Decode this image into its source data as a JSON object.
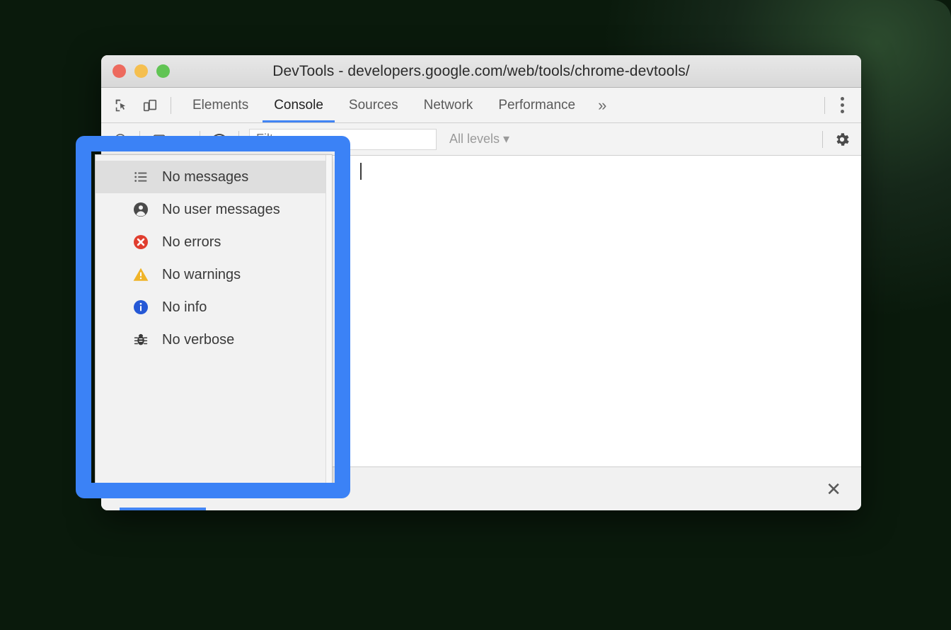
{
  "window": {
    "title": "DevTools - developers.google.com/web/tools/chrome-devtools/",
    "traffic_lights": [
      {
        "name": "close",
        "color": "#ed6a5e"
      },
      {
        "name": "minimize",
        "color": "#f5bf4f"
      },
      {
        "name": "zoom",
        "color": "#61c454"
      }
    ]
  },
  "tabstrip": {
    "left_icons": [
      {
        "name": "inspect-element-icon",
        "glyph": "inspect"
      },
      {
        "name": "device-toolbar-icon",
        "glyph": "device"
      }
    ],
    "tabs": [
      {
        "label": "Elements",
        "active": false
      },
      {
        "label": "Console",
        "active": true
      },
      {
        "label": "Sources",
        "active": false
      },
      {
        "label": "Network",
        "active": false
      },
      {
        "label": "Performance",
        "active": false
      }
    ],
    "overflow_label": "»",
    "menu_icon": "kebab-menu-icon",
    "active_tab_color": "#4285f4"
  },
  "console_toolbar": {
    "context_caret": "▾",
    "eye_icon": "live-expression-eye-icon",
    "filter": {
      "value": "",
      "placeholder": "Filter"
    },
    "levels_label": "All levels ▾",
    "settings_icon": "gear-icon"
  },
  "console_body": {
    "prompt_caret": "|",
    "messages": []
  },
  "drawer": {
    "close_label": "✕",
    "accent_color": "#4285f4"
  },
  "level_dropdown": {
    "items": [
      {
        "label": "No messages",
        "icon": "list-icon",
        "icon_color": "#5f5f5f",
        "selected": true
      },
      {
        "label": "No user messages",
        "icon": "person-icon",
        "icon_color": "#4a4a4a",
        "selected": false
      },
      {
        "label": "No errors",
        "icon": "error-circle-icon",
        "icon_color": "#e03e2f",
        "selected": false
      },
      {
        "label": "No warnings",
        "icon": "warning-triangle-icon",
        "icon_color": "#f0b429",
        "selected": false
      },
      {
        "label": "No info",
        "icon": "info-circle-icon",
        "icon_color": "#2558d6",
        "selected": false
      },
      {
        "label": "No verbose",
        "icon": "bug-icon",
        "icon_color": "#3a3a3a",
        "selected": false
      }
    ]
  },
  "annotation": {
    "highlight_color": "#3b82f6",
    "name": "level-filter-dropdown-highlight"
  }
}
